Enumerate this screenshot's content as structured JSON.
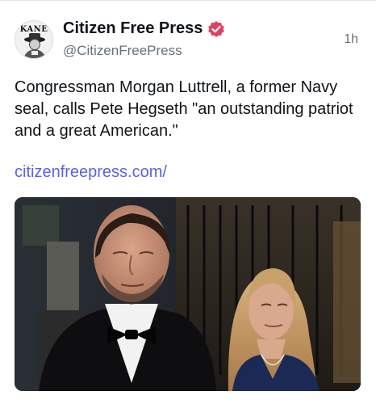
{
  "post": {
    "display_name": "Citizen Free Press",
    "handle": "@CitizenFreePress",
    "time": "1h",
    "avatar_text": "KANE",
    "body": "Congressman Morgan Luttrell, a former Navy seal, calls Pete Hegseth \"an outstanding patriot and a great American.\"",
    "link": "citizenfreepress.com/"
  },
  "colors": {
    "verified_badge": "#e0415e",
    "link": "#5b61e9",
    "muted_text": "#66717a"
  },
  "icons": {
    "verified": "verified-badge-icon"
  }
}
